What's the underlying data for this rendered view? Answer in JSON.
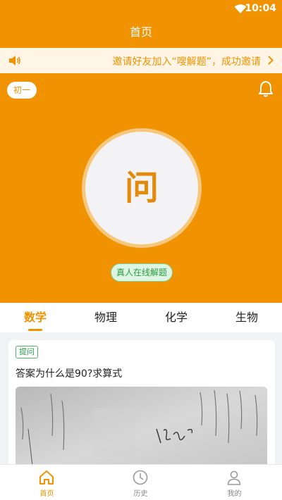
{
  "status_bar": {
    "time": "10:04"
  },
  "header": {
    "title": "首页"
  },
  "notice": {
    "text": "邀请好友加入“嗖解题”，成功邀请"
  },
  "hero": {
    "grade": "初一",
    "ask_label": "问",
    "live_badge": "真人在线解题"
  },
  "subjects": [
    {
      "label": "数学",
      "active": true
    },
    {
      "label": "物理",
      "active": false
    },
    {
      "label": "化学",
      "active": false
    },
    {
      "label": "生物",
      "active": false
    }
  ],
  "question_card": {
    "tag": "提问",
    "text": "答案为什么是90?求算式"
  },
  "bottom_nav": [
    {
      "label": "首页",
      "icon": "home-icon",
      "active": true
    },
    {
      "label": "历史",
      "icon": "clock-icon",
      "active": false
    },
    {
      "label": "我的",
      "icon": "user-icon",
      "active": false
    }
  ],
  "colors": {
    "brand": "#f19300",
    "green": "#2a9a44"
  }
}
